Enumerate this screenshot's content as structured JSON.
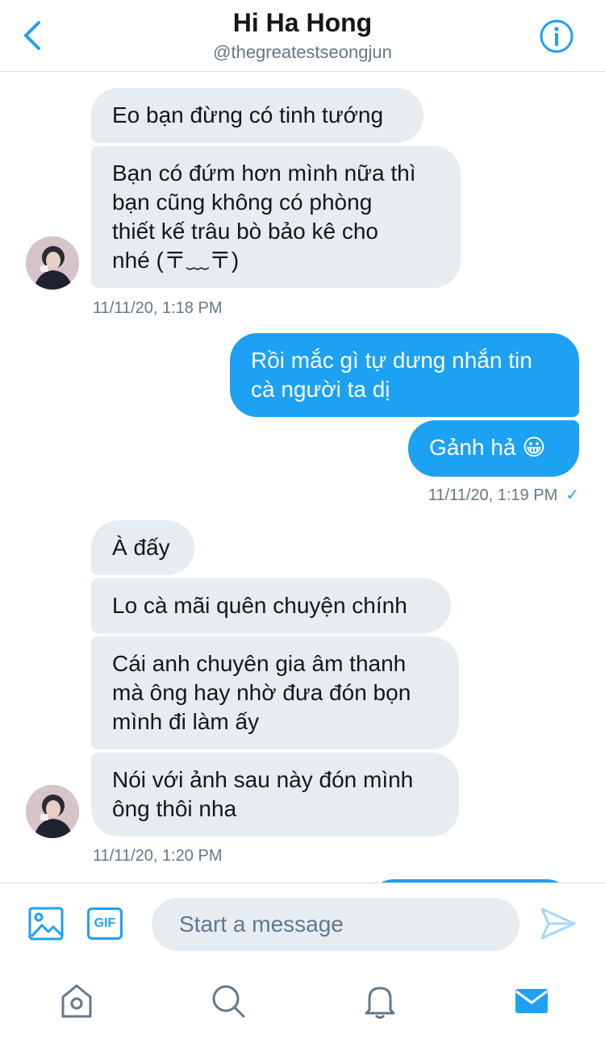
{
  "header": {
    "title": "Hi Ha Hong",
    "handle": "@thegreatestseongjun",
    "back_icon": "chevron-left-icon",
    "info_icon": "info-icon"
  },
  "messages": [
    {
      "side": "in",
      "text": "Eo bạn đừng có tinh tướng"
    },
    {
      "side": "in",
      "text": "Bạn có đứm hơn mình nữa thì\nbạn cũng không có phòng\nthiết kế trâu bò bảo kê cho\nnhé (〒﹏〒)"
    },
    {
      "side": "in",
      "text": "À đấy"
    },
    {
      "side": "in",
      "text": "Lo cà mãi quên chuyện chính"
    },
    {
      "side": "in",
      "text": "Cái anh chuyên gia âm thanh\nmà ông hay nhờ đưa đón bọn\nmình đi làm ấy"
    },
    {
      "side": "in",
      "text": "Nói với ảnh sau này đón mình\nông thôi nha"
    },
    {
      "side": "out",
      "text": "Rồi mắc gì tự dưng nhắn tin\ncà người ta dị"
    },
    {
      "side": "out",
      "text": "Gảnh hả 😀"
    }
  ],
  "timestamps": {
    "group1": "11/11/20, 1:18 PM",
    "group2": "11/11/20, 1:19 PM",
    "group3": "11/11/20, 1:20 PM"
  },
  "read_check": "✓",
  "composer": {
    "placeholder": "Start a message",
    "gif_label": "GIF"
  },
  "colors": {
    "accent": "#1da1f2",
    "incoming_bubble": "#e6ecf0",
    "muted_text": "#657786"
  }
}
